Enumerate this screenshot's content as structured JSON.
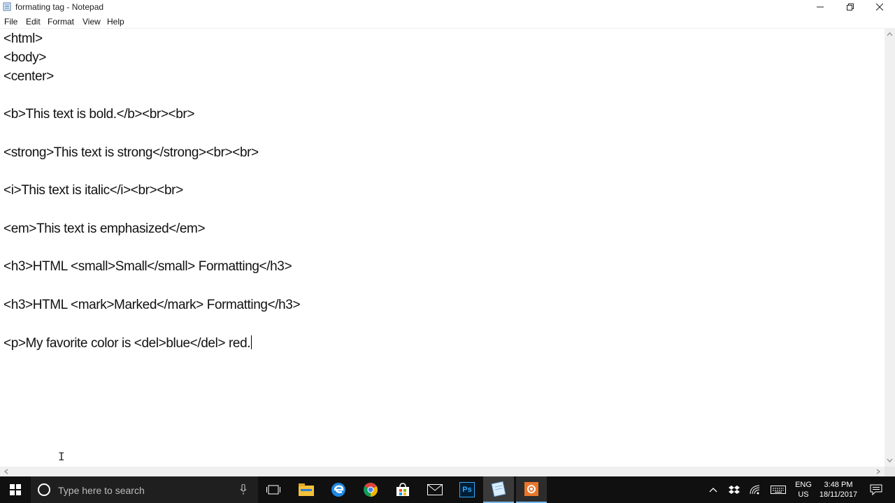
{
  "window": {
    "title": "formating tag - Notepad",
    "icon": "notepad-icon",
    "controls": [
      "minimize-icon",
      "restore-icon",
      "close-icon"
    ]
  },
  "menu": [
    "File",
    "Edit",
    "Format",
    "View",
    "Help"
  ],
  "editor": {
    "lines": [
      "<html>",
      "<body>",
      "<center>",
      "",
      "<b>This text is bold.</b><br><br>",
      "",
      "<strong>This text is strong</strong><br><br>",
      "",
      "<i>This text is italic</i><br><br>",
      "",
      "<em>This text is emphasized</em>",
      "",
      "<h3>HTML <small>Small</small> Formatting</h3>",
      "",
      "<h3>HTML <mark>Marked</mark> Formatting</h3>",
      "",
      "<p>My favorite color is <del>blue</del> red."
    ]
  },
  "taskbar": {
    "search_placeholder": "Type here to search",
    "apps": [
      "windows-start-icon",
      "task-view-icon",
      "file-explorer-icon",
      "edge-icon",
      "chrome-icon",
      "store-icon",
      "mail-icon",
      "photoshop-icon",
      "notepad-taskbar-icon",
      "recorder-icon"
    ],
    "photoshop_label": "Ps",
    "lang_line1": "ENG",
    "lang_line2": "US",
    "time": "3:48 PM",
    "date": "18/11/2017"
  },
  "colors": {
    "taskbar": "#101010",
    "accent_blue": "#0078d7",
    "edge_blue": "#1e88e5",
    "ps_blue": "#001e36",
    "ps_text": "#31a8ff"
  }
}
